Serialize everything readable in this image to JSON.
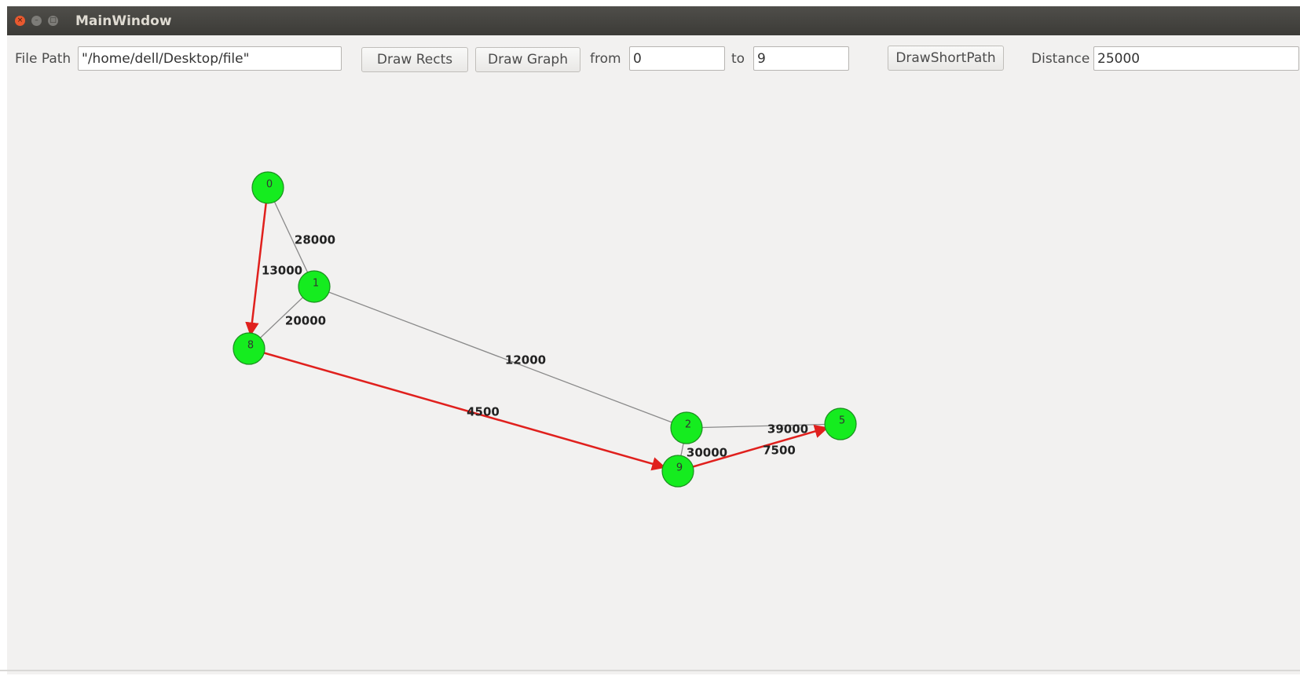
{
  "window": {
    "title": "MainWindow",
    "close_glyph": "×",
    "minimize_glyph": "–",
    "maximize_glyph": "□"
  },
  "toolbar": {
    "file_path_label": "File Path",
    "file_path_value": "\"/home/dell/Desktop/file\"",
    "draw_rects_label": "Draw Rects",
    "draw_graph_label": "Draw Graph",
    "from_label": "from",
    "from_value": "0",
    "to_label": "to",
    "to_value": "9",
    "draw_short_path_label": "DrawShortPath",
    "distance_label": "Distance",
    "distance_value": "25000"
  },
  "graph": {
    "colors": {
      "node_fill": "#15ec1f",
      "node_stroke": "#1a8f1e",
      "edge": "#8a8a8a",
      "path": "#e0201d"
    },
    "nodes": [
      {
        "id": "0",
        "label": "0"
      },
      {
        "id": "1",
        "label": "1"
      },
      {
        "id": "8",
        "label": "8"
      },
      {
        "id": "2",
        "label": "2"
      },
      {
        "id": "9",
        "label": "9"
      },
      {
        "id": "5",
        "label": "5"
      }
    ],
    "edges": [
      {
        "from": "0",
        "to": "1",
        "weight": "28000",
        "on_path": false
      },
      {
        "from": "0",
        "to": "8",
        "weight": "13000",
        "on_path": true
      },
      {
        "from": "1",
        "to": "8",
        "weight": "20000",
        "on_path": false
      },
      {
        "from": "1",
        "to": "2",
        "weight": "12000",
        "on_path": false
      },
      {
        "from": "8",
        "to": "9",
        "weight": "4500",
        "on_path": true
      },
      {
        "from": "2",
        "to": "5",
        "weight": "39000",
        "on_path": false
      },
      {
        "from": "2",
        "to": "9",
        "weight": "30000",
        "on_path": false
      },
      {
        "from": "9",
        "to": "5",
        "weight": "7500",
        "on_path": true
      }
    ]
  }
}
